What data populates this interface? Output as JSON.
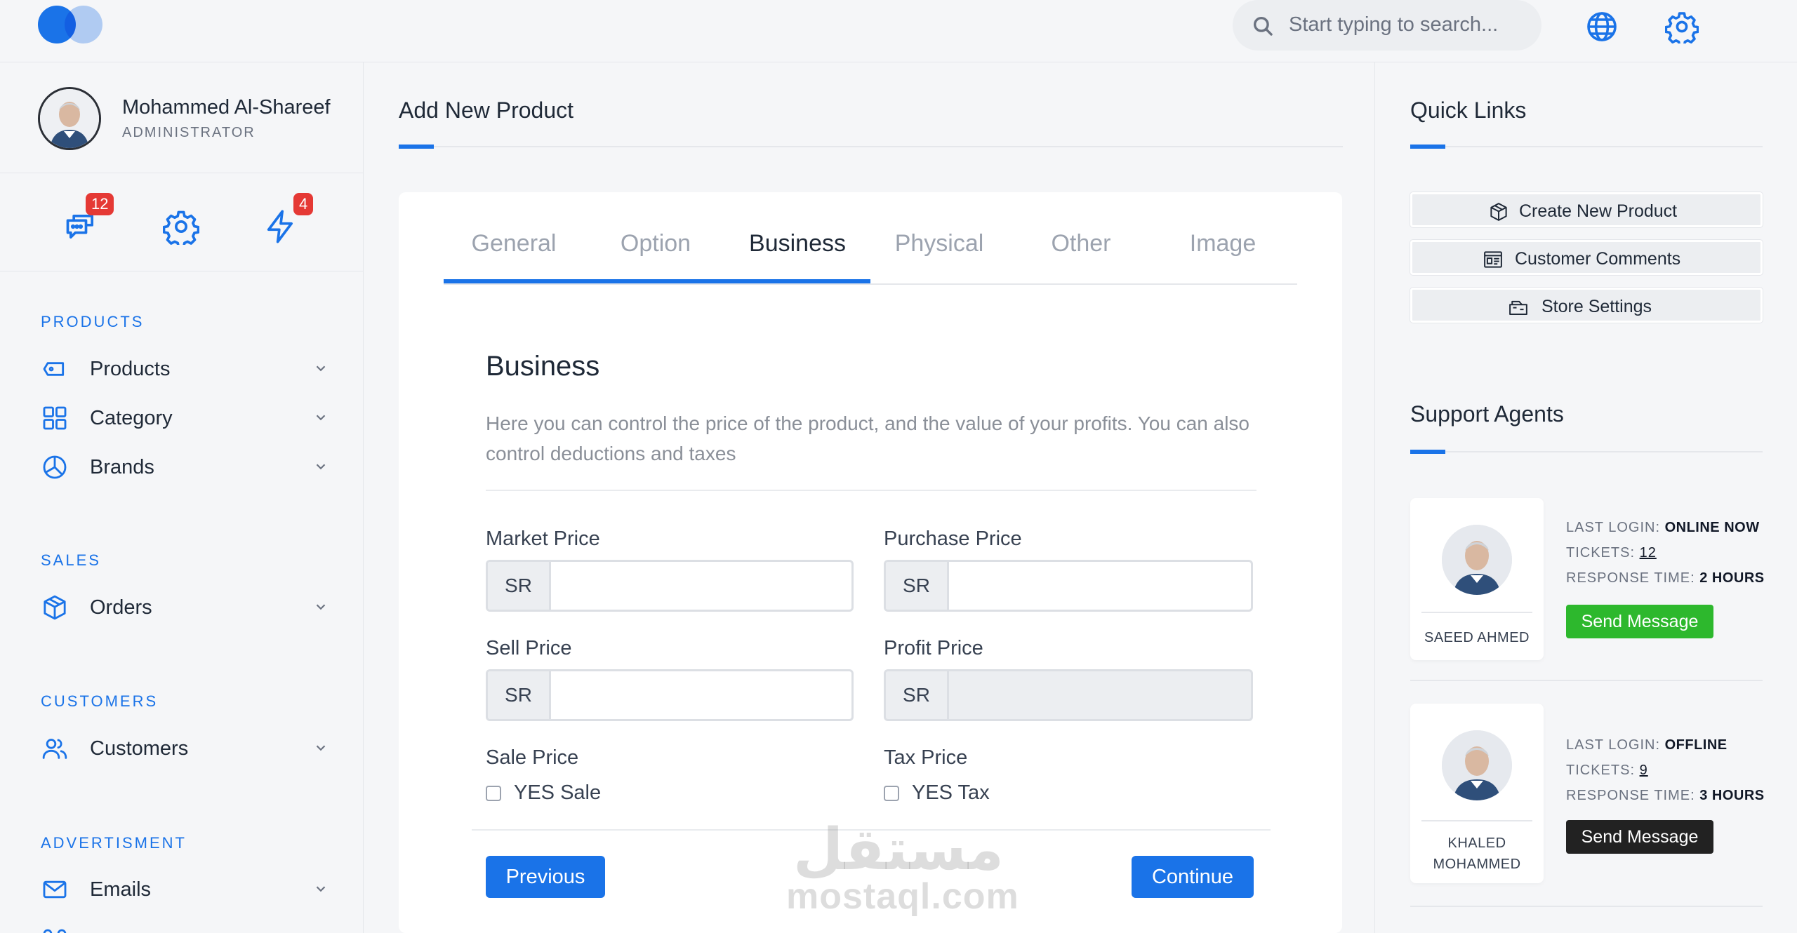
{
  "header": {
    "search_placeholder": "Start typing to search...",
    "icons": [
      "search-icon",
      "globe-icon",
      "gear-icon"
    ]
  },
  "user": {
    "name": "Mohammed Al-Shareef",
    "role": "ADMINISTRATOR"
  },
  "quick_icons": {
    "messages_count": "12",
    "notifications_count": "4"
  },
  "sidebar": {
    "sections": [
      {
        "title": "PRODUCTS",
        "items": [
          {
            "label": "Products",
            "icon": "tag-icon"
          },
          {
            "label": "Category",
            "icon": "grid-icon"
          },
          {
            "label": "Brands",
            "icon": "pie-chart-icon"
          }
        ]
      },
      {
        "title": "SALES",
        "items": [
          {
            "label": "Orders",
            "icon": "box-icon"
          }
        ]
      },
      {
        "title": "CUSTOMERS",
        "items": [
          {
            "label": "Customers",
            "icon": "users-icon"
          }
        ]
      },
      {
        "title": "ADVERTISMENT",
        "items": [
          {
            "label": "Emails",
            "icon": "mail-icon"
          }
        ]
      }
    ]
  },
  "main": {
    "title": "Add New Product",
    "tabs": [
      "General",
      "Option",
      "Business",
      "Physical",
      "Other",
      "Image"
    ],
    "active_tab": "Business",
    "section_title": "Business",
    "section_desc": "Here you can control the price of the product, and the value of your profits. You can also control deductions and taxes",
    "fields": {
      "market_price": {
        "label": "Market Price",
        "addon": "SR",
        "value": ""
      },
      "purchase_price": {
        "label": "Purchase Price",
        "addon": "SR",
        "value": ""
      },
      "sell_price": {
        "label": "Sell Price",
        "addon": "SR",
        "value": ""
      },
      "profit_price": {
        "label": "Profit Price",
        "addon": "SR",
        "value": "",
        "disabled": true
      },
      "sale_price": {
        "label": "Sale Price",
        "checkbox_label": "YES Sale",
        "checked": false
      },
      "tax_price": {
        "label": "Tax Price",
        "checkbox_label": "YES Tax",
        "checked": false
      }
    },
    "previous_label": "Previous",
    "continue_label": "Continue",
    "watermark": {
      "arabic": "مستقل",
      "latin": "mostaql.com"
    }
  },
  "right": {
    "quick_links_title": "Quick Links",
    "quick_links": [
      {
        "label": "Create New Product",
        "icon": "box-icon"
      },
      {
        "label": "Customer Comments",
        "icon": "comments-icon"
      },
      {
        "label": "Store Settings",
        "icon": "store-icon"
      }
    ],
    "agents_title": "Support Agents",
    "agents": [
      {
        "name": "SAEED AHMED",
        "last_login_label": "LAST LOGIN:",
        "last_login": "ONLINE NOW",
        "tickets_label": "TICKETS:",
        "tickets": "12",
        "response_label": "RESPONSE TIME:",
        "response": "2 HOURS",
        "button": "Send Message",
        "button_color": "#2db82d"
      },
      {
        "name_line1": "KHALED",
        "name_line2": "MOHAMMED",
        "last_login_label": "LAST LOGIN:",
        "last_login": "OFFLINE",
        "tickets_label": "TICKETS:",
        "tickets": "9",
        "response_label": "RESPONSE TIME:",
        "response": "3 HOURS",
        "button": "Send Message",
        "button_color": "#222222"
      }
    ]
  },
  "colors": {
    "accent": "#1a73e8",
    "danger": "#e53935",
    "success": "#2db82d",
    "dark": "#222222"
  }
}
